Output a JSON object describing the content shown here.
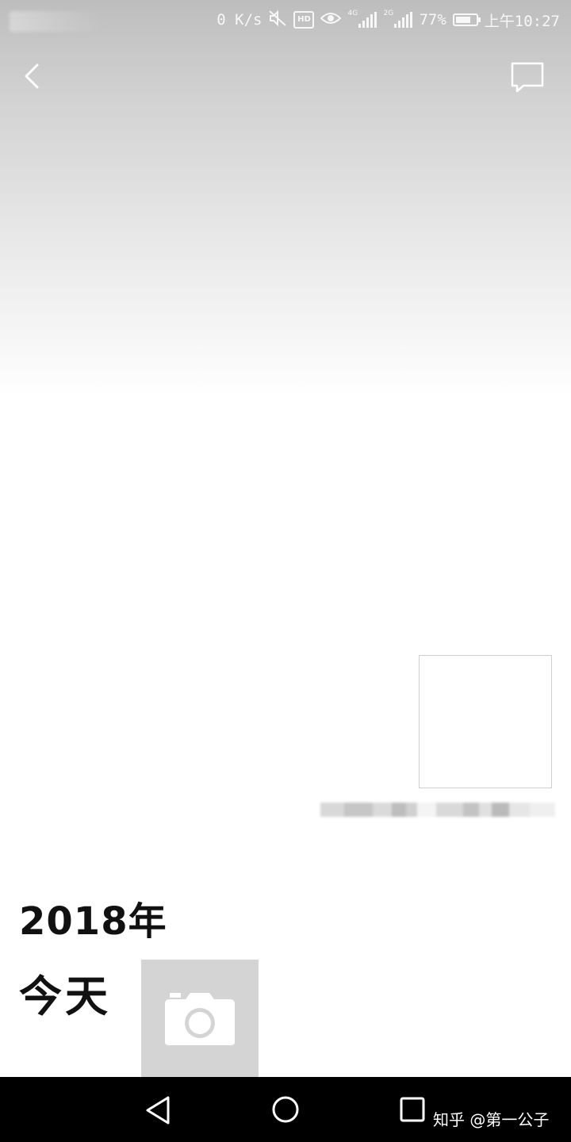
{
  "status_bar": {
    "net_speed": "0 K/s",
    "hd_label": "HD",
    "net1_generation": "4G",
    "net2_generation": "2G",
    "battery_percent": "77%",
    "battery_level": 0.77,
    "time": "上午10:27",
    "icons": [
      "mute-icon",
      "hd-icon",
      "eye-icon",
      "signal-4g-icon",
      "signal-2g-icon",
      "battery-icon"
    ]
  },
  "header": {
    "back_icon": "chevron-left-icon",
    "comment_icon": "speech-bubble-icon"
  },
  "profile": {
    "avatar_icon": "avatar-placeholder"
  },
  "timeline": {
    "year": "2018年",
    "today": "今天",
    "camera_icon": "camera-icon"
  },
  "nav_bar": {
    "icons": [
      "triangle-back-icon",
      "circle-home-icon",
      "square-recents-icon"
    ],
    "watermark": "知乎 @第一公子"
  },
  "colors": {
    "cover_top": "#bdbdbd",
    "camera_bg": "#d4d4d4",
    "nav_bg": "#000000",
    "text": "#111111"
  }
}
